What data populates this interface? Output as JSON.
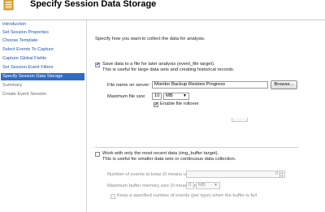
{
  "header": {
    "title": "Specify Session Data Storage",
    "icon": "session-icon"
  },
  "sidebar": {
    "items": [
      {
        "label": "Introduction"
      },
      {
        "label": "Set Session Properties"
      },
      {
        "label": "Choose Template"
      },
      {
        "label": "Select Events To Capture"
      },
      {
        "label": "Capture Global Fields"
      },
      {
        "label": "Set Session Event Filters"
      },
      {
        "label": "Specify Session Data Storage"
      },
      {
        "label": "Summary"
      },
      {
        "label": "Create Event Session"
      }
    ],
    "active_index": 6
  },
  "main": {
    "intro": "Specify how you want to collect the data for analysis.",
    "file_target": {
      "checked": true,
      "label": "Save data to a file for later analysis (event_file target).",
      "help": "This is useful for large data sets and creating historical records.",
      "file_name_label": "File name on server:",
      "file_name_value": "Monitor Backup Restore Progress",
      "browse_label": "Browse...",
      "max_size_label": "Maximum file size:",
      "max_size_value": "10",
      "max_size_unit": "MB",
      "rollover_checked": true,
      "rollover_label": "Enable file rollover"
    },
    "ring_target": {
      "checked": false,
      "label": "Work with only the most recent data (ring_buffer target).",
      "help": "This is useful for smaller data sets or continuous data collection.",
      "events_label": "Number of events to keep (0 means unlimited):",
      "events_value": "0",
      "memory_label": "Maximum buffer memory size (0 means unlimited):",
      "memory_value": "0",
      "memory_unit": "MB",
      "per_type_label": "Keep a specified number of events (per type) when the buffer is full"
    }
  }
}
